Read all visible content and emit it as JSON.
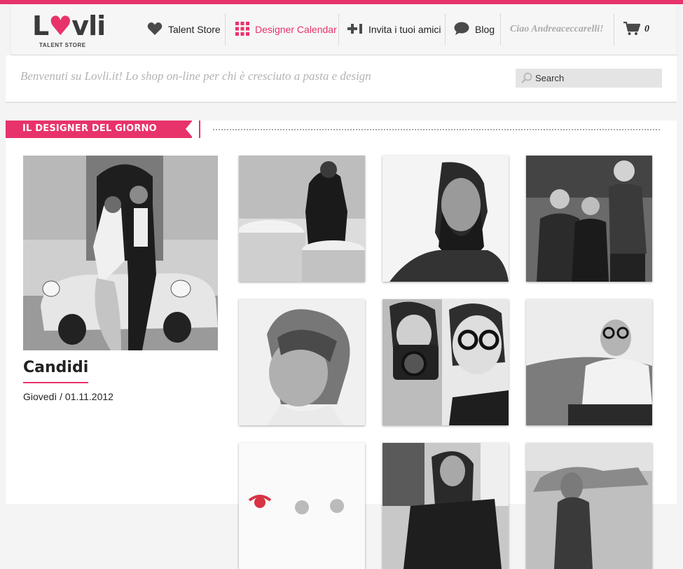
{
  "brand": {
    "name": "Lovli",
    "subtitle": "TALENT STORE"
  },
  "nav": {
    "talent_store": "Talent Store",
    "designer_calendar": "Designer Calendar",
    "invite_friends": "Invita i tuoi amici",
    "blog": "Blog",
    "user_greeting": "Ciao Andreaceccarelli!",
    "cart_count": "0"
  },
  "colors": {
    "accent": "#e8336a"
  },
  "welcome": "Benvenuti su Lovli.it! Lo shop on-line per chi è cresciuto a pasta e design",
  "search": {
    "placeholder": "Search"
  },
  "section": {
    "title": "IL DESIGNER DEL GIORNO"
  },
  "featured": {
    "name": "Candidi",
    "date": "Giovedì / 01.11.2012"
  },
  "icons": [
    "heart-icon",
    "calendar-grid-icon",
    "plus-one-icon",
    "speech-bubble-icon",
    "cart-icon",
    "search-icon"
  ]
}
